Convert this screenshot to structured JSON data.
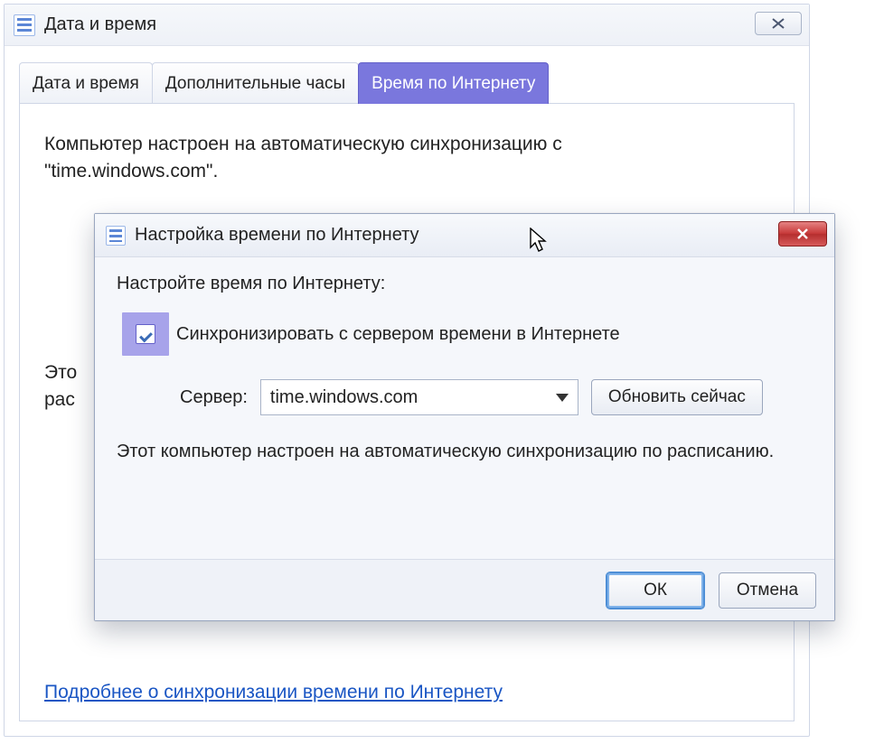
{
  "main_window": {
    "title": "Дата и время",
    "tabs": [
      {
        "label": "Дата и время"
      },
      {
        "label": "Дополнительные часы"
      },
      {
        "label": "Время по Интернету"
      }
    ],
    "sync_text_line1": "Компьютер настроен на автоматическую синхронизацию с",
    "sync_text_line2": "\"time.windows.com\".",
    "cut_text_line1": "Это",
    "cut_text_line2": "рас",
    "link_label": "Подробнее о синхронизации времени по Интернету"
  },
  "dialog": {
    "title": "Настройка времени по Интернету",
    "subhead": "Настройте время по Интернету:",
    "checkbox_label": "Синхронизировать с сервером времени в Интернете",
    "checkbox_checked": true,
    "server_label": "Сервер:",
    "server_value": "time.windows.com",
    "update_button": "Обновить сейчас",
    "desc": "Этот компьютер настроен на автоматическую синхронизацию по расписанию.",
    "ok_label": "ОК",
    "cancel_label": "Отмена"
  }
}
